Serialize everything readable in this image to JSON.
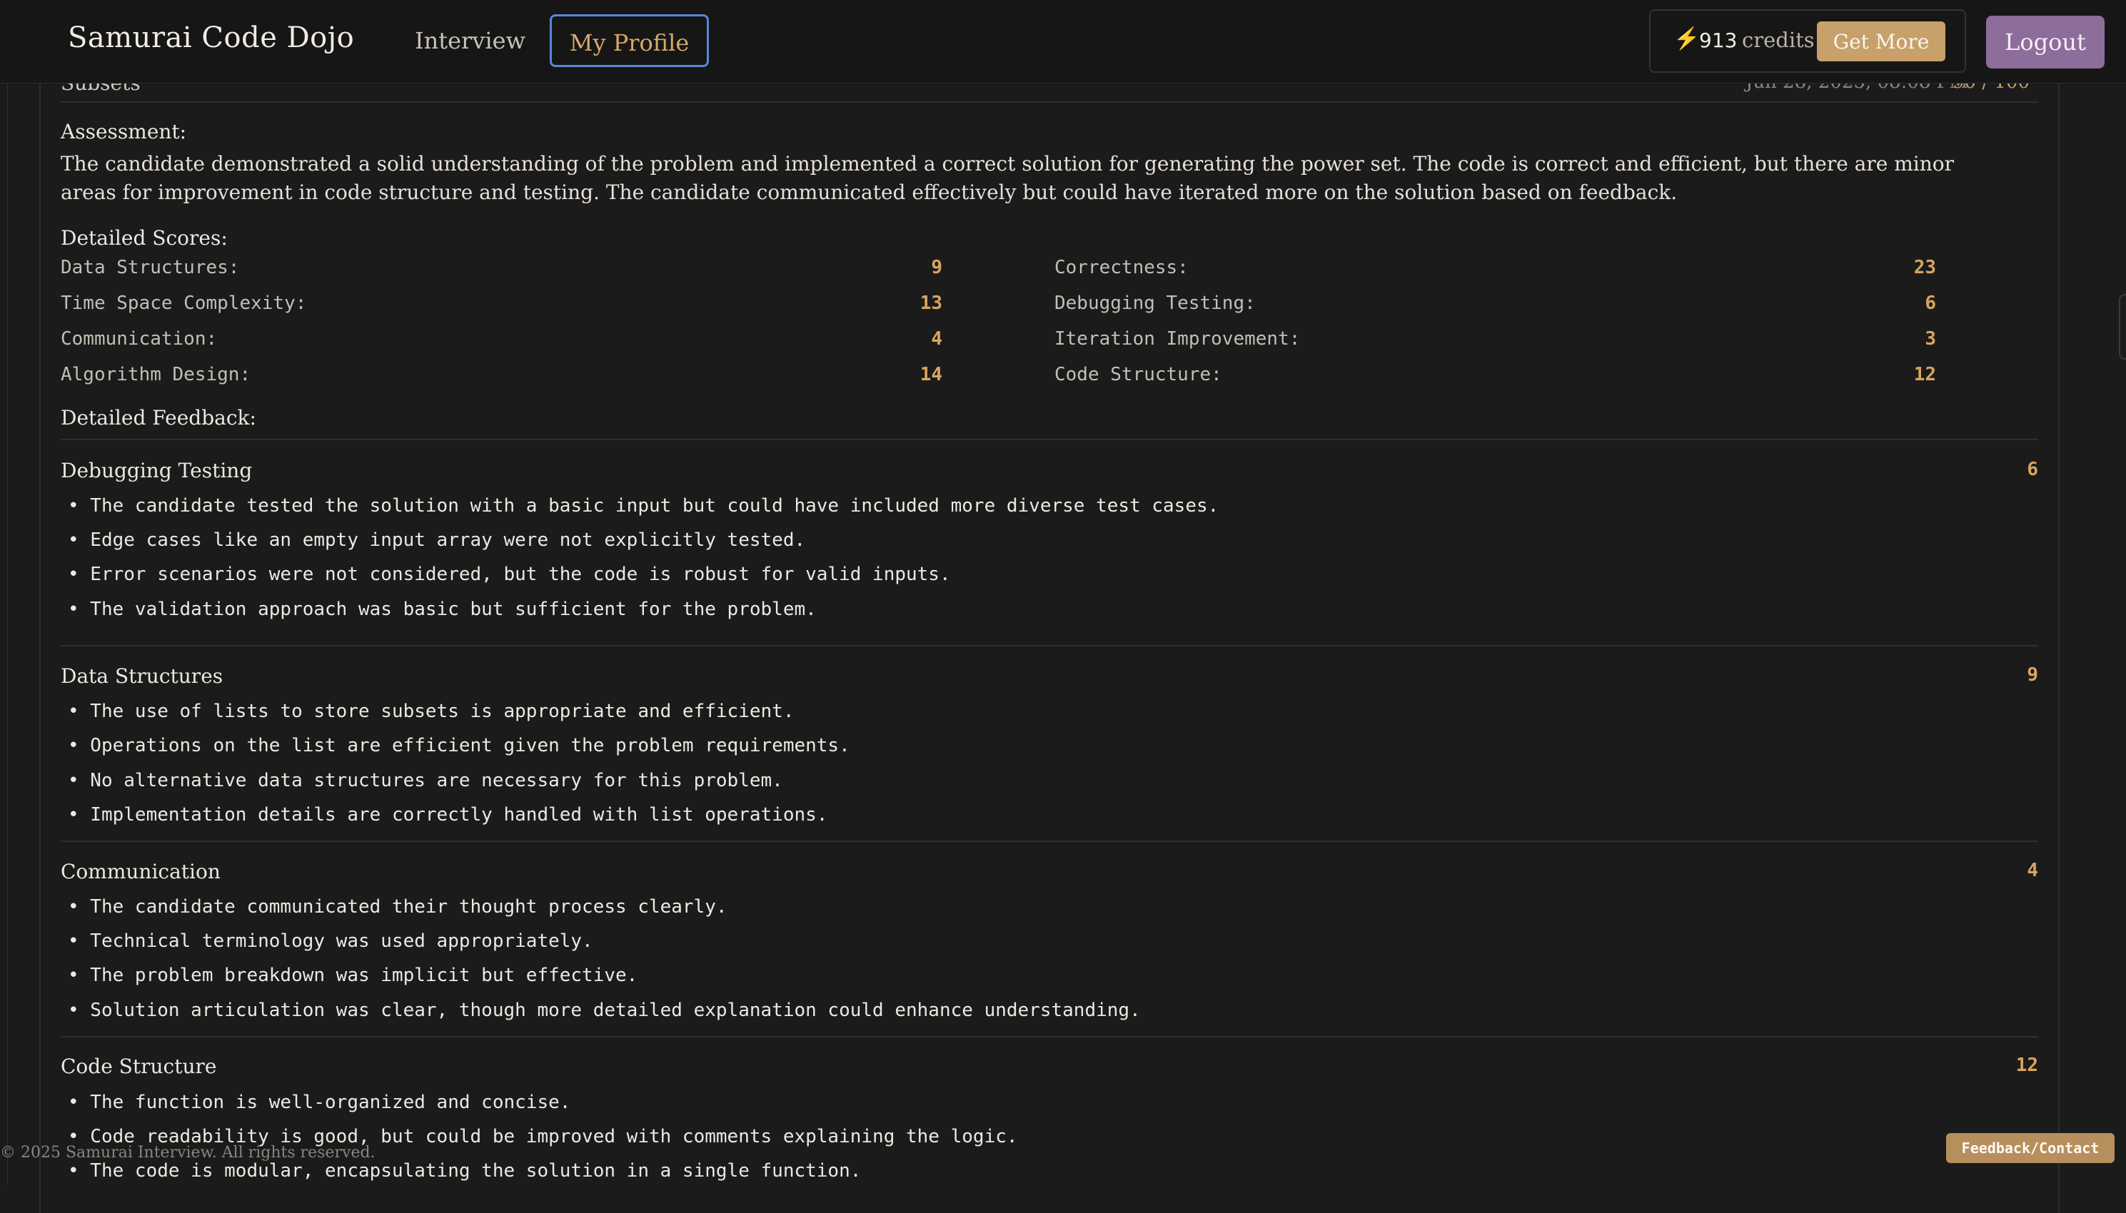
{
  "header": {
    "brand": "Samurai Code Dojo",
    "nav": {
      "interview": "Interview",
      "profile": "My Profile"
    },
    "credits": {
      "icon": "lightning-icon",
      "amount": "913",
      "label": "credits",
      "get_more": "Get More"
    },
    "logout": "Logout"
  },
  "partial_header": {
    "title": "Subsets",
    "date": "Jun 28, 2025, 08:08 PM",
    "meta": "90 / 100"
  },
  "assessment": {
    "label": "Assessment:",
    "text": "The candidate demonstrated a solid understanding of the problem and implemented a correct solution for generating the power set. The code is correct and efficient, but there are minor areas for improvement in code structure and testing. The candidate communicated effectively but could have iterated more on the solution based on feedback."
  },
  "scores": {
    "label": "Detailed Scores:",
    "left": [
      {
        "name": "Data Structures:",
        "value": "9"
      },
      {
        "name": "Time Space Complexity:",
        "value": "13"
      },
      {
        "name": "Communication:",
        "value": "4"
      },
      {
        "name": "Algorithm Design:",
        "value": "14"
      }
    ],
    "right": [
      {
        "name": "Correctness:",
        "value": "23"
      },
      {
        "name": "Debugging Testing:",
        "value": "6"
      },
      {
        "name": "Iteration Improvement:",
        "value": "3"
      },
      {
        "name": "Code Structure:",
        "value": "12"
      }
    ]
  },
  "feedback": {
    "label": "Detailed Feedback:",
    "sections": [
      {
        "title": "Debugging Testing",
        "score": "6",
        "items": [
          "• The candidate tested the solution with a basic input but could have included more diverse test cases.",
          "• Edge cases like an empty input array were not explicitly tested.",
          "• Error scenarios were not considered, but the code is robust for valid inputs.",
          "• The validation approach was basic but sufficient for the problem."
        ]
      },
      {
        "title": "Data Structures",
        "score": "9",
        "items": [
          "• The use of lists to store subsets is appropriate and efficient.",
          "• Operations on the list are efficient given the problem requirements.",
          "• No alternative data structures are necessary for this problem.",
          "• Implementation details are correctly handled with list operations."
        ]
      },
      {
        "title": "Communication",
        "score": "4",
        "items": [
          "• The candidate communicated their thought process clearly.",
          "• Technical terminology was used appropriately.",
          "• The problem breakdown was implicit but effective.",
          "• Solution articulation was clear, though more detailed explanation could enhance understanding."
        ]
      },
      {
        "title": "Code Structure",
        "score": "12",
        "items": [
          "• The function is well-organized and concise.",
          "• Code readability is good, but could be improved with comments explaining the logic.",
          "• The code is modular, encapsulating the solution in a single function."
        ]
      }
    ]
  },
  "footer": {
    "copyright": "© 2025 Samurai Interview. All rights reserved.",
    "feedback_button": "Feedback/Contact"
  },
  "colors": {
    "accent": "#d9a55e",
    "logout": "#8d6d99",
    "get_more": "#c8a06a",
    "background": "#1b1b1b"
  }
}
